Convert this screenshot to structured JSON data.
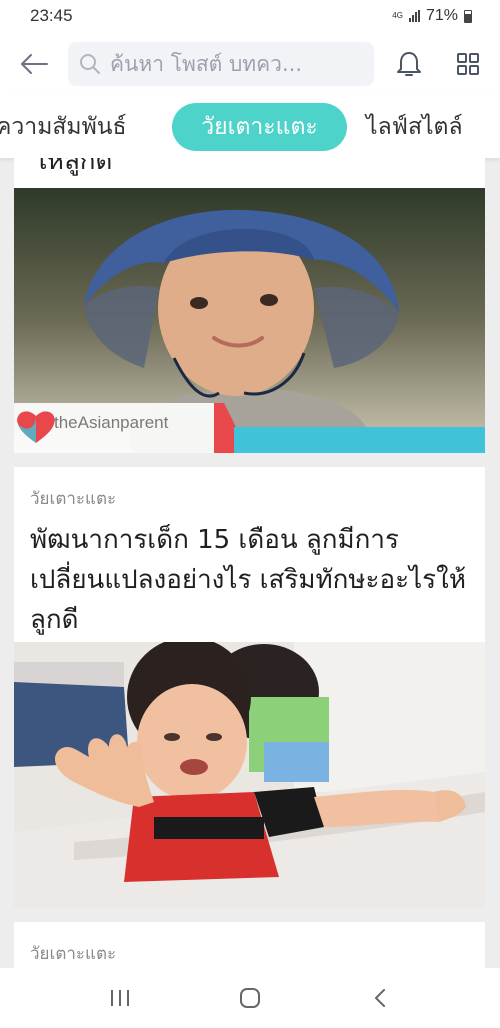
{
  "status": {
    "time": "23:45",
    "network": "4G",
    "battery": "71%"
  },
  "search": {
    "placeholder": "ค้นหา โพสต์ บทคว..."
  },
  "tabs": [
    {
      "label": "ความสัมพันธ์"
    },
    {
      "label": "วัยเตาะแตะ"
    },
    {
      "label": "ไลฟ์สไตล์"
    }
  ],
  "colors": {
    "accent": "#4ed3cb",
    "logo_red": "#e8474c",
    "logo_cyan": "#3ec3d8"
  },
  "cards": [
    {
      "title_tail": "ให้ลูกดี",
      "image_logo": "theAsianparent"
    },
    {
      "category": "วัยเตาะแตะ",
      "headline": "พัฒนาการเด็ก 15 เดือน ลูกมีการเปลี่ยนแปลงอย่างไร เสริมทักษะอะไรให้ลูกดี"
    },
    {
      "category": "วัยเตาะแตะ"
    }
  ],
  "icons": {
    "back": "arrow-left-icon",
    "search": "search-icon",
    "bell": "bell-icon",
    "grid": "grid-icon",
    "recents": "recents-icon",
    "home": "home-icon",
    "nav_back": "chevron-left-icon"
  }
}
